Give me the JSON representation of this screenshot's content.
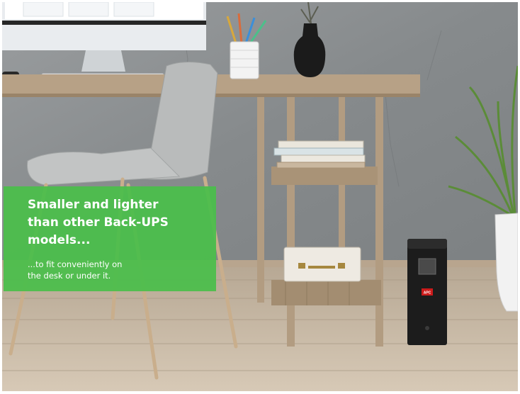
{
  "promo": {
    "headline": "Smaller and lighter\nthan other Back-UPS\nmodels...",
    "subtext": "...to fit conveniently on\nthe desk or under it."
  },
  "ups": {
    "brand": "APC"
  },
  "colors": {
    "promo_green": "#4cbe4c",
    "wall": "#8a8e90",
    "floor": "#c8b9a4",
    "desk_wood": "#b09a80"
  }
}
